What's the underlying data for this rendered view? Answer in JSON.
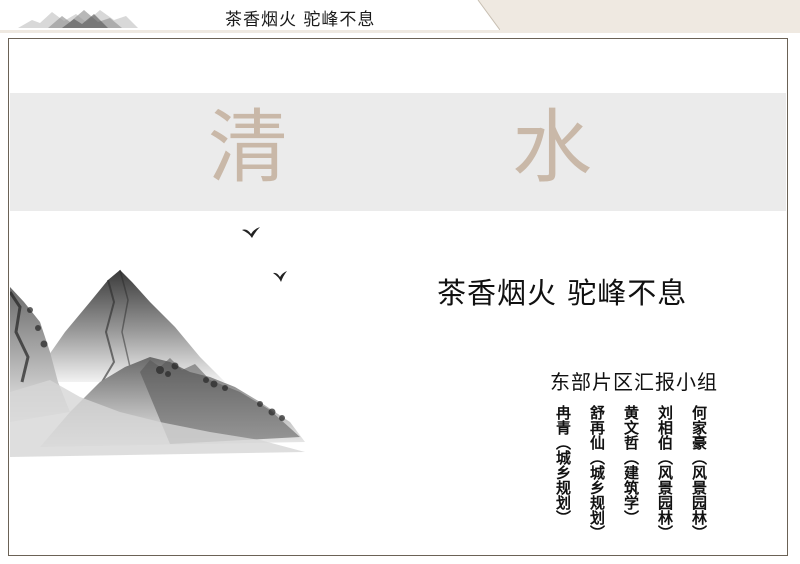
{
  "header": {
    "title": "茶香烟火 驼峰不息"
  },
  "hero": {
    "char_left": "清",
    "char_right": "水"
  },
  "subtitle": "茶香烟火 驼峰不息",
  "team": {
    "name": "东部片区汇报小组",
    "members": [
      "何家豪（风景园林）",
      "刘相伯（风景园林）",
      "黄文哲（建筑学）",
      "舒再仙（城乡规划）",
      "冉青（城乡规划）"
    ]
  },
  "colors": {
    "accent": "#c9b8a8",
    "band": "#ebebeb",
    "header_band": "#efe9e1",
    "frame": "#6b6256"
  }
}
